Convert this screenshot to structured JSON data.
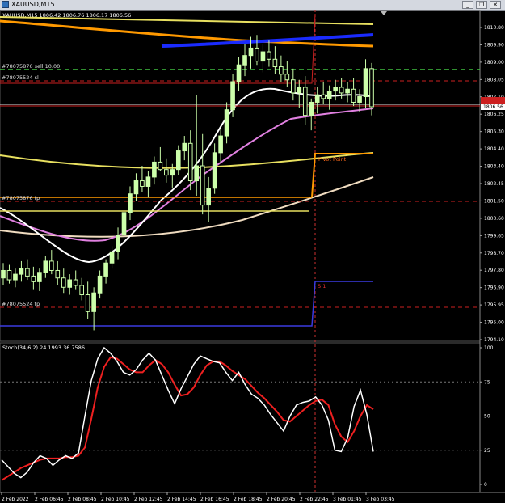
{
  "window": {
    "title": "XAUUSD,M15",
    "buttons": {
      "minimize": "_",
      "restore": "❐",
      "close": "✕"
    }
  },
  "main_panel": {
    "header": "XAUUSD,M15  1806.42 1806.76 1806.17 1806.56",
    "order_labels": {
      "sell_order": "#78075876 sell 10.00",
      "sl_order": "#78075524 sl",
      "tp_order_1": "#78075876 tp",
      "tp_order_2": "#78075524 tp"
    },
    "level_labels": {
      "pivot": "Pivot Point",
      "support": "S 1"
    },
    "current_price": "1806.56",
    "price_axis": [
      "1810.80",
      "1809.90",
      "1809.00",
      "1808.05",
      "1807.10",
      "1806.25",
      "1805.30",
      "1804.40",
      "1803.40",
      "1802.45",
      "1801.50",
      "1800.60",
      "1799.65",
      "1798.70",
      "1797.80",
      "1796.90",
      "1795.95",
      "1795.00",
      "1794.10"
    ]
  },
  "indicator_panel": {
    "header": "Stoch(34,6,2) 24.1993 36.7586",
    "axis": [
      "100",
      "75",
      "50",
      "25",
      "0"
    ]
  },
  "time_axis": [
    "2 Feb 2022",
    "2 Feb 06:45",
    "2 Feb 08:45",
    "2 Feb 10:45",
    "2 Feb 12:45",
    "2 Feb 14:45",
    "2 Feb 16:45",
    "2 Feb 18:45",
    "2 Feb 20:45",
    "2 Feb 22:45",
    "3 Feb 01:45",
    "3 Feb 03:45"
  ],
  "colors": {
    "background": "#000000",
    "candle": "#ccffaa",
    "ma_fast": "#ffffff",
    "ma_slow": "#e080e0",
    "ma_yellow": "#e8e060",
    "ma_orange": "#ff9900",
    "ma_blue": "#1a2bff",
    "ma_beige": "#f0dcc0",
    "pivot": "#ff8800",
    "support": "#3a3ae0",
    "order_line": "#cc2020",
    "stoch_main": "#ffffff",
    "stoch_signal": "#ee2020"
  },
  "chart_data": {
    "type": "candlestick",
    "symbol": "XAUUSD",
    "timeframe": "M15",
    "ohlc_current": {
      "open": 1806.42,
      "high": 1806.76,
      "low": 1806.17,
      "close": 1806.56
    },
    "ylim": [
      1794.1,
      1811.0
    ],
    "candles": [
      [
        1797.4,
        1798.2,
        1797.0,
        1797.8
      ],
      [
        1797.8,
        1798.1,
        1797.1,
        1797.3
      ],
      [
        1797.3,
        1797.9,
        1796.9,
        1797.6
      ],
      [
        1797.6,
        1798.3,
        1797.2,
        1797.9
      ],
      [
        1797.9,
        1798.4,
        1797.3,
        1797.5
      ],
      [
        1797.5,
        1798.0,
        1796.8,
        1797.2
      ],
      [
        1797.2,
        1797.9,
        1796.7,
        1797.7
      ],
      [
        1797.7,
        1798.6,
        1797.4,
        1798.3
      ],
      [
        1798.3,
        1798.9,
        1797.6,
        1797.8
      ],
      [
        1797.8,
        1798.3,
        1797.0,
        1797.4
      ],
      [
        1797.4,
        1797.9,
        1796.6,
        1796.9
      ],
      [
        1796.9,
        1797.6,
        1796.5,
        1797.3
      ],
      [
        1797.3,
        1797.8,
        1796.8,
        1797.0
      ],
      [
        1797.0,
        1797.4,
        1796.2,
        1796.5
      ],
      [
        1796.5,
        1797.2,
        1795.2,
        1795.6
      ],
      [
        1795.6,
        1796.9,
        1794.6,
        1796.6
      ],
      [
        1796.6,
        1797.8,
        1796.3,
        1797.5
      ],
      [
        1797.5,
        1798.4,
        1797.1,
        1798.2
      ],
      [
        1798.2,
        1799.1,
        1797.9,
        1798.8
      ],
      [
        1798.8,
        1800.1,
        1798.4,
        1799.7
      ],
      [
        1799.7,
        1801.2,
        1799.3,
        1800.9
      ],
      [
        1800.9,
        1802.3,
        1800.5,
        1801.9
      ],
      [
        1801.9,
        1803.0,
        1801.5,
        1802.6
      ],
      [
        1802.6,
        1803.4,
        1802.0,
        1802.3
      ],
      [
        1802.3,
        1803.1,
        1801.7,
        1802.8
      ],
      [
        1802.8,
        1803.9,
        1802.4,
        1803.6
      ],
      [
        1803.6,
        1804.4,
        1803.1,
        1803.2
      ],
      [
        1803.2,
        1803.8,
        1802.5,
        1802.9
      ],
      [
        1802.9,
        1803.5,
        1802.2,
        1803.2
      ],
      [
        1803.2,
        1804.5,
        1802.9,
        1804.2
      ],
      [
        1804.2,
        1805.0,
        1803.7,
        1804.6
      ],
      [
        1804.6,
        1805.3,
        1802.1,
        1802.6
      ],
      [
        1802.6,
        1807.2,
        1801.8,
        1803.4
      ],
      [
        1803.4,
        1805.1,
        1800.8,
        1801.3
      ],
      [
        1801.3,
        1802.8,
        1800.4,
        1802.2
      ],
      [
        1802.2,
        1804.6,
        1801.9,
        1804.1
      ],
      [
        1804.1,
        1805.4,
        1803.6,
        1805.0
      ],
      [
        1805.0,
        1806.8,
        1804.6,
        1806.4
      ],
      [
        1806.4,
        1808.3,
        1806.0,
        1807.9
      ],
      [
        1807.9,
        1809.2,
        1807.4,
        1808.8
      ],
      [
        1808.8,
        1809.9,
        1808.2,
        1809.3
      ],
      [
        1809.3,
        1810.3,
        1808.6,
        1809.7
      ],
      [
        1809.7,
        1810.4,
        1808.8,
        1809.0
      ],
      [
        1809.0,
        1809.9,
        1808.4,
        1809.5
      ],
      [
        1809.5,
        1810.1,
        1808.7,
        1809.1
      ],
      [
        1809.1,
        1809.8,
        1808.3,
        1808.7
      ],
      [
        1808.7,
        1809.3,
        1807.9,
        1808.3
      ],
      [
        1808.3,
        1809.0,
        1807.6,
        1808.0
      ],
      [
        1808.0,
        1808.6,
        1806.9,
        1807.3
      ],
      [
        1807.3,
        1808.0,
        1806.5,
        1807.6
      ],
      [
        1807.6,
        1808.2,
        1805.6,
        1806.1
      ],
      [
        1806.1,
        1807.0,
        1805.3,
        1806.8
      ],
      [
        1806.8,
        1807.6,
        1806.2,
        1807.2
      ],
      [
        1807.2,
        1807.9,
        1806.7,
        1807.0
      ],
      [
        1807.0,
        1807.7,
        1806.4,
        1807.4
      ],
      [
        1807.4,
        1808.0,
        1806.9,
        1807.6
      ],
      [
        1807.6,
        1808.1,
        1807.0,
        1807.3
      ],
      [
        1807.3,
        1807.9,
        1806.8,
        1807.5
      ],
      [
        1807.5,
        1808.1,
        1806.6,
        1806.8
      ],
      [
        1806.8,
        1807.5,
        1806.3,
        1807.1
      ],
      [
        1807.1,
        1809.1,
        1806.5,
        1808.6
      ],
      [
        1808.6,
        1808.9,
        1806.1,
        1806.56
      ]
    ],
    "stochastic": {
      "main": [
        18,
        13,
        8,
        5,
        9,
        16,
        21,
        19,
        14,
        18,
        21,
        19,
        23,
        50,
        76,
        92,
        100,
        96,
        90,
        82,
        80,
        84,
        91,
        96,
        91,
        80,
        69,
        59,
        70,
        79,
        88,
        94,
        92,
        90,
        89,
        82,
        76,
        82,
        73,
        66,
        63,
        58,
        51,
        45,
        39,
        50,
        58,
        60,
        61,
        64,
        58,
        47,
        25,
        24,
        34,
        57,
        69,
        51,
        24
      ],
      "signal": [
        3,
        6,
        9,
        12,
        14,
        16,
        18,
        19,
        19,
        19,
        20,
        20,
        21,
        27,
        48,
        71,
        86,
        93,
        92,
        88,
        84,
        82,
        82,
        87,
        91,
        88,
        82,
        73,
        65,
        66,
        71,
        80,
        87,
        90,
        90,
        87,
        83,
        80,
        77,
        72,
        67,
        63,
        58,
        53,
        47,
        46,
        50,
        54,
        58,
        61,
        62,
        58,
        44,
        35,
        31,
        39,
        50,
        58,
        55
      ]
    },
    "levels": {
      "sell_entry": 1808.3,
      "sl": 1807.85,
      "tp_1": 1801.5,
      "tp_2": 1795.5,
      "pivot_point": 1804.0,
      "support_1": 1797.0
    }
  }
}
